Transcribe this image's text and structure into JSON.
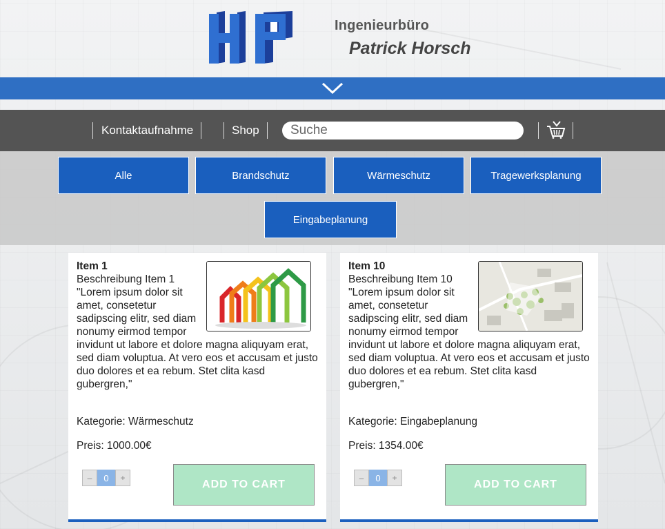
{
  "brand": {
    "logo_text": "HP",
    "line1": "Ingenieurbüro",
    "line2": "Patrick Horsch"
  },
  "nav": {
    "items": [
      {
        "label": "Kontaktaufnahme"
      },
      {
        "label": ""
      },
      {
        "label": "Shop"
      }
    ],
    "search_placeholder": "Suche",
    "cart_icon": "basket-icon"
  },
  "filters": [
    "Alle",
    "Brandschutz",
    "Wärmeschutz",
    "Tragewerksplanung",
    "Eingabeplanung"
  ],
  "colors": {
    "primary_blue": "#1a5fbe",
    "bar_blue": "#2f6fc3",
    "nav_gray": "#545454",
    "cart_button": "#afe6c6"
  },
  "products": [
    {
      "title": "Item 1",
      "description_heading": "Beschreibung Item 1",
      "description": "\"Lorem ipsum dolor sit amet, consetetur sadipscing elitr, sed diam nonumy eirmod tempor invidunt ut labore et dolore magna aliquyam erat, sed diam voluptua. At vero eos et accusam et justo duo dolores et ea rebum. Stet clita kasd gubergren,\"",
      "category": "Kategorie: Wärmeschutz",
      "price": "Preis: 1000.00€",
      "quantity": "0",
      "minus": "–",
      "plus": "+",
      "add_to_cart": "ADD TO CART",
      "image": "energy-house-icon"
    },
    {
      "title": "Item 10",
      "description_heading": "Beschreibung Item 10",
      "description": "\"Lorem ipsum dolor sit amet, consetetur sadipscing elitr, sed diam nonumy eirmod tempor invidunt ut labore et dolore magna aliquyam erat, sed diam voluptua. At vero eos et accusam et justo duo dolores et ea rebum. Stet clita kasd gubergren,\"",
      "category": "Kategorie: Eingabeplanung",
      "price": "Preis: 1354.00€",
      "quantity": "0",
      "minus": "–",
      "plus": "+",
      "add_to_cart": "ADD TO CART",
      "image": "site-plan-icon"
    }
  ]
}
